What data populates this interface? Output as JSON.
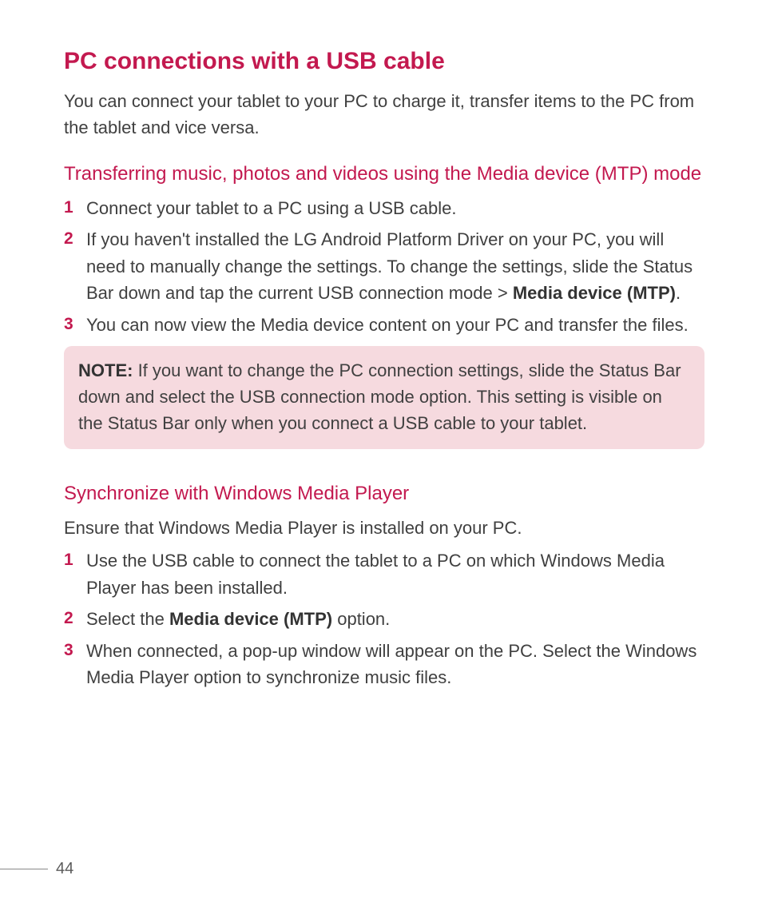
{
  "page": {
    "title": "PC connections with a USB cable",
    "intro": "You can connect your tablet to your PC to charge it, transfer items to the PC from the tablet and vice versa.",
    "section1": {
      "heading": "Transferring music, photos and videos using the Media device (MTP) mode",
      "steps": [
        {
          "num": "1",
          "text": "Connect your tablet to a PC using a USB cable."
        },
        {
          "num": "2",
          "pre": "If you haven't installed the LG Android Platform Driver on your PC, you will need to manually change the settings. To change the settings, slide the Status Bar down and tap the current USB connection mode > ",
          "bold": "Media device (MTP)",
          "post": "."
        },
        {
          "num": "3",
          "text": "You can now view the Media device content on your PC and transfer the files."
        }
      ],
      "note": {
        "label": "NOTE:",
        "text": " If you want to change the PC connection settings, slide the Status Bar down and select the USB connection mode option. This setting is visible on the Status Bar only when you connect a USB cable to your tablet."
      }
    },
    "section2": {
      "heading": "Synchronize with Windows Media Player",
      "intro": "Ensure that Windows Media Player is installed on your PC.",
      "steps": [
        {
          "num": "1",
          "text": "Use the USB cable to connect the tablet to a PC on which Windows Media Player has been installed."
        },
        {
          "num": "2",
          "pre": "Select the ",
          "bold": "Media device (MTP)",
          "post": " option."
        },
        {
          "num": "3",
          "text": "When connected, a pop-up window will appear on the PC. Select the Windows Media Player option to synchronize music files."
        }
      ]
    },
    "page_number": "44"
  }
}
